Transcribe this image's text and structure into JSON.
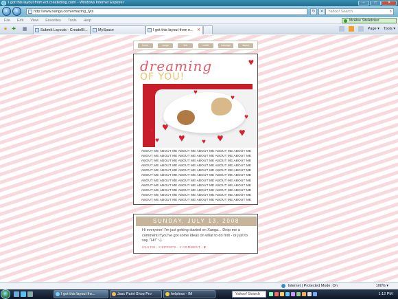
{
  "window": {
    "title": "I got this layout from ect.createblog.com! - Windows Internet Explorer",
    "min": "–",
    "max": "□",
    "close": "✕"
  },
  "address": {
    "url": "http://www.xanga.com/emazing_lyts",
    "search_placeholder": "Yahoo! Search"
  },
  "menu": [
    "File",
    "Edit",
    "View",
    "Favorites",
    "Tools",
    "Help"
  ],
  "addon": "McAfee SiteAdvisor",
  "tabs": [
    {
      "label": "Submit Layouts - CreateBl..."
    },
    {
      "label": "MySpace"
    },
    {
      "label": "I got this layout from e..."
    }
  ],
  "commandbar": {
    "page": "Page ▾",
    "tools": "Tools ▾"
  },
  "page": {
    "nav": [
      "home",
      "xanga",
      "link",
      "credit",
      "message",
      "layout"
    ],
    "header_title": "dreaming",
    "header_subtitle": "OF YOU!",
    "about_text": "ABOUT ME ABOUT ME ABOUT ME ABOUT ME ABOUT ME ABOUT ME ABOUT ME ABOUT ME ABOUT ME ABOUT ME ABOUT ME ABOUT ME ABOUT ME ABOUT ME ABOUT ME ABOUT ME ABOUT ME ABOUT ME ABOUT ME ABOUT ME ABOUT ME ABOUT ME ABOUT ME ABOUT ME ABOUT ME ABOUT ME ABOUT ME ABOUT ME ABOUT ME ABOUT ME ABOUT ME ABOUT ME ABOUT ME ABOUT ME ABOUT ME ABOUT ME ABOUT ME ABOUT ME ABOUT ME ABOUT ME ABOUT ME ABOUT ME ABOUT ME ABOUT ME ABOUT ME ABOUT ME ABOUT ME ABOUT ME ABOUT ME ABOUT ME ABOUT ME ABOUT ME ABOUT ME ABOUT ME ABOUT ME ABOUT ME ABOUT ME ABOUT ME ABOUT ME ABOUT ME ABOUT ME ABOUT ME ABOUT ME ABOUT ME ABOUT ME ABOUT ME ABOUT ME ABOUT ME",
    "post_date": "SUNDAY, JULY 13, 2008",
    "post_body": "Hi everyone! I'm just getting started on Xanga... Drop me a comment if you've got some ideas on what to do first - or just to say, \"Hi!\" :-)",
    "post_meta": "6:13 PM - 2 EPROPS - 1 COMMENT -"
  },
  "status": {
    "zone": "Internet | Protected Mode: On",
    "zoom": "100% ▾"
  },
  "taskbar": {
    "tasks": [
      {
        "label": "I got this layout fro..."
      },
      {
        "label": "Jasc Paint Shop Pro"
      },
      {
        "label": "helpless - IM"
      }
    ],
    "search": "Yahoo! Search",
    "time": "1:12 PM"
  },
  "colors": {
    "accent": "#c6b49b",
    "heart": "#d61f2f",
    "stripe": "#f8d9dd"
  }
}
